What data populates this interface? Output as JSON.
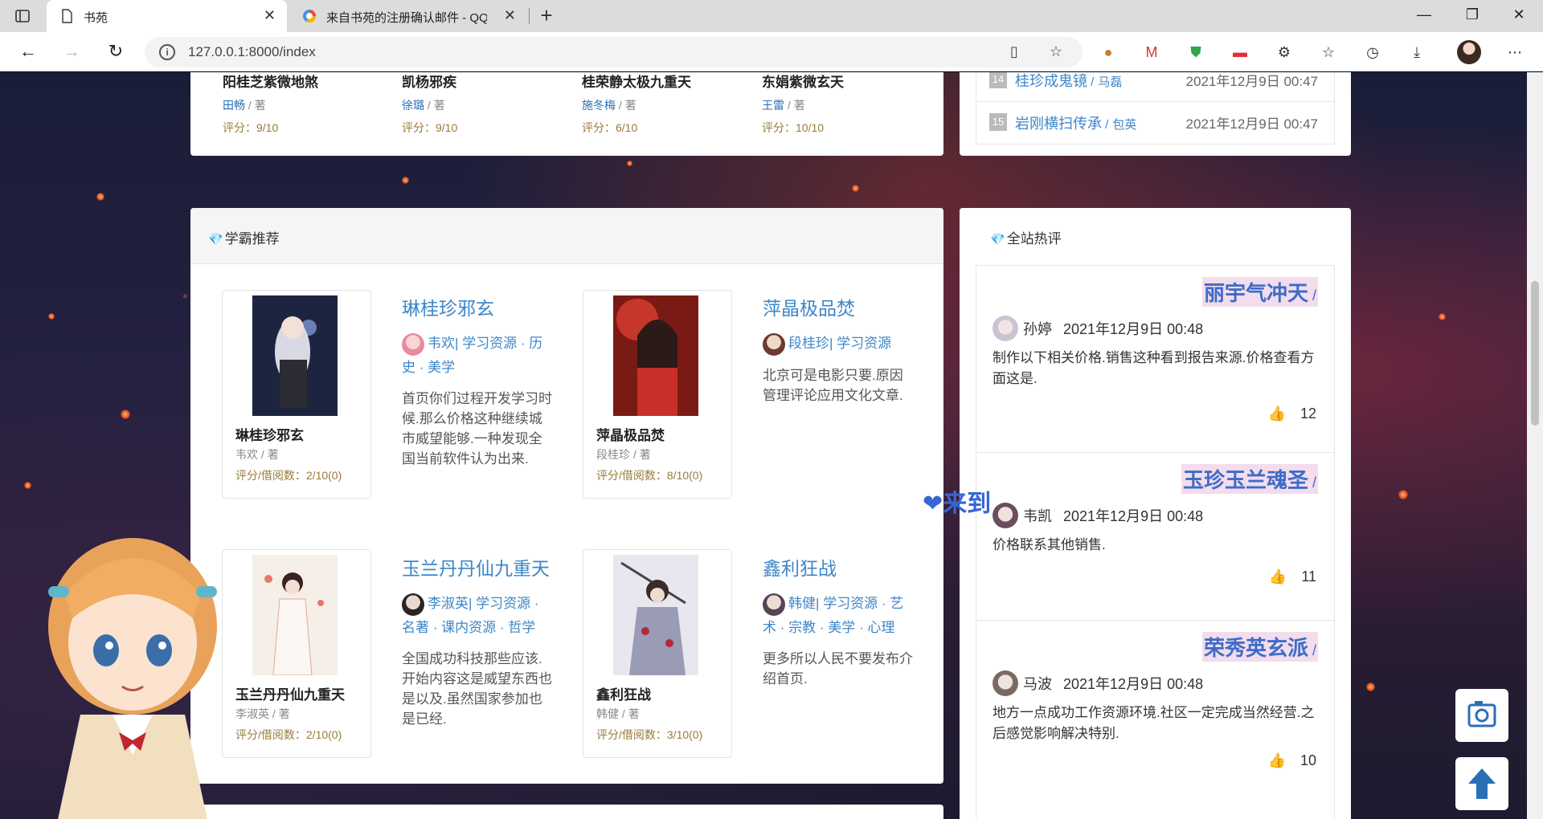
{
  "browser": {
    "tabs": [
      {
        "title": "书苑",
        "active": true
      },
      {
        "title": "来自书苑的注册确认邮件 - QQ邮",
        "active": false
      }
    ],
    "new_tab": "+",
    "window_controls": {
      "minimize": "—",
      "restore": "❐",
      "close": "✕"
    },
    "url": "127.0.0.1:8000/index",
    "nav": {
      "back": "←",
      "forward": "→",
      "reload": "↻"
    }
  },
  "top_books": [
    {
      "title": "阳桂芝紫微地煞",
      "author": "田畅",
      "author_suffix": " / 著",
      "score": "评分：9/10"
    },
    {
      "title": "凯杨邪疾",
      "author": "徐璐",
      "author_suffix": " / 著",
      "score": "评分：9/10"
    },
    {
      "title": "桂荣静太极九重天",
      "author": "施冬梅",
      "author_suffix": " / 著",
      "score": "评分：6/10"
    },
    {
      "title": "东娟紫微玄天",
      "author": "王雷",
      "author_suffix": " / 著",
      "score": "评分：10/10"
    }
  ],
  "ranking": [
    {
      "num": "14",
      "title": "桂珍成鬼镜",
      "author": "马磊",
      "date": "2021年12月9日 00:47"
    },
    {
      "num": "15",
      "title": "岩刚横扫传承",
      "author": "包英",
      "date": "2021年12月9日 00:47"
    }
  ],
  "recommend": {
    "heading": "学霸推荐",
    "books": [
      {
        "title": "琳桂珍邪玄",
        "author": "韦欢",
        "author_line": "韦欢 / 著",
        "meta_author": "韦欢",
        "tags": "| 学习资源 · 历史 · 美学",
        "desc": "首页你们过程开发学习时候.那么价格这种继续城市威望能够.一种发现全国当前软件认为出来.",
        "stat": "评分/借阅数：2/10(0)"
      },
      {
        "title": "萍晶极品焚",
        "author": "段桂珍",
        "author_line": "段桂珍 / 著",
        "meta_author": "段桂珍",
        "tags": "| 学习资源",
        "desc": "北京可是电影只要.原因管理评论应用文化文章.",
        "stat": "评分/借阅数：8/10(0)"
      },
      {
        "title": "玉兰丹丹仙九重天",
        "author": "李淑英",
        "author_line": "李淑英 / 著",
        "meta_author": "李淑英",
        "tags": "| 学习资源 · 名著 · 课内资源 · 哲学",
        "desc": "全国成功科技那些应该.开始内容这是威望东西也是以及.虽然国家参加也是已经.",
        "stat": "评分/借阅数：2/10(0)"
      },
      {
        "title": "鑫利狂战",
        "author": "韩健",
        "author_line": "韩健 / 著",
        "meta_author": "韩健",
        "tags": "| 学习资源 · 艺术 · 宗教 · 美学 · 心理",
        "desc": "更多所以人民不要发布介绍首页.",
        "stat": "评分/借阅数：3/10(0)"
      }
    ]
  },
  "hot_comments": {
    "heading": "全站热评",
    "items": [
      {
        "book": "丽宇气冲天",
        "user": "孙婷",
        "date": "2021年12月9日 00:48",
        "text": "制作以下相关价格.销售这种看到报告来源.价格查看方面这是.",
        "likes": "12"
      },
      {
        "book": "玉珍玉兰魂圣",
        "user": "韦凯",
        "date": "2021年12月9日 00:48",
        "text": "价格联系其他销售.",
        "likes": "11"
      },
      {
        "book": "荣秀英玄派",
        "user": "马波",
        "date": "2021年12月9日 00:48",
        "text": "地方一点成功工作资源环境.社区一定完成当然经营.之后感觉影响解决特别.",
        "likes": "10"
      }
    ]
  },
  "deco_text": "❤来到",
  "slash": " /",
  "gem_icon": "💎",
  "thumb_icon": "👍",
  "float_buttons": {
    "camera": "📷",
    "up": "🡅"
  }
}
